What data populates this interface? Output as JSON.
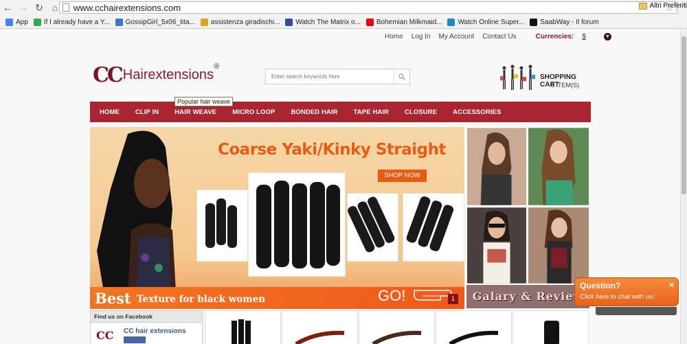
{
  "browser": {
    "url": "www.cchairextensions.com",
    "bookmarks": [
      {
        "label": "App",
        "icon": "apps-grid-icon",
        "color": "#4285f4"
      },
      {
        "label": "If I already have a Y...",
        "icon": "google-icon",
        "color": "#34a853"
      },
      {
        "label": "GossipGirl_5x06_tita...",
        "icon": "c-logo-icon",
        "color": "#3b78c9"
      },
      {
        "label": "assistenza giradischi...",
        "icon": "hand-icon",
        "color": "#d9a520"
      },
      {
        "label": "Watch The Matrix o...",
        "icon": "page-icon",
        "color": "#2d4f9e"
      },
      {
        "label": "Bohemian Milkmaid...",
        "icon": "youtube-icon",
        "color": "#e00"
      },
      {
        "label": "Watch Online Super...",
        "icon": "box-icon",
        "color": "#1e88c8"
      },
      {
        "label": "SaabWay - Il forum",
        "icon": "saab-icon",
        "color": "#111"
      }
    ],
    "other_bookmarks": "Altri Preferiti"
  },
  "header": {
    "links": [
      "Home",
      "Log In",
      "My Account",
      "Contact Us"
    ],
    "currencies_label": "Currencies:",
    "currency_value": "$",
    "logo_cc": "CC",
    "logo_text": "Hairextensions",
    "logo_reg": "®",
    "search_placeholder": "Enter search keywords here",
    "cart_title": "SHOPPING CART",
    "cart_count": "0 ITEM(S)"
  },
  "nav": [
    "HOME",
    "CLIP IN",
    "HAIR WEAVE",
    "MICRO LOOP",
    "BONDED HAIR",
    "TAPE HAIR",
    "CLOSURE",
    "ACCESSORIES"
  ],
  "banner": {
    "headline": "Coarse Yaki/Kinky Straight",
    "shop_now": "SHOP NOW",
    "tooltip": "Popular hair weave",
    "best": "Best",
    "best_sub": "Texture for black women",
    "go": "GO!",
    "slide_number": "1"
  },
  "side_gallery": {
    "label_a": "Galary",
    "label_b": " & ",
    "label_c": "Review"
  },
  "facebook": {
    "heading": "Find us on Facebook",
    "page_name": "CC hair extensions",
    "logo": "CC"
  },
  "chat": {
    "question": "Question?",
    "sub": "Click here to chat with us!",
    "close": "×"
  }
}
